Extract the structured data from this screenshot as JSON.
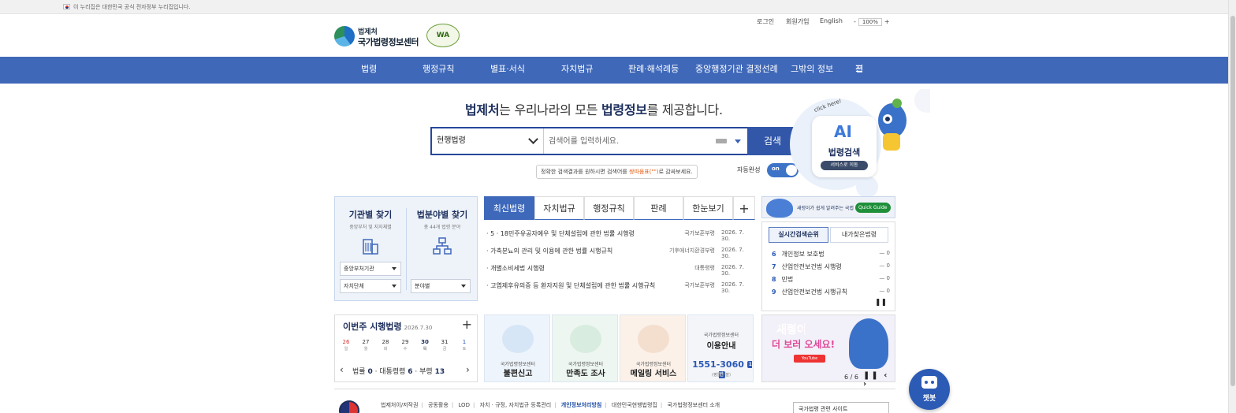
{
  "gov_notice": "이 누리집은 대한민국 공식 전자정부 누리집입니다.",
  "logo": {
    "line1": "법제처",
    "line2": "국가법령정보센터",
    "wa_mark": "WA"
  },
  "util": {
    "login": "로그인",
    "signup": "회원가입",
    "english": "English",
    "zoom": "100%",
    "zoom_minus": "-",
    "zoom_plus": "+"
  },
  "nav": {
    "items": [
      "법령",
      "행정규칙",
      "별표·서식",
      "자치법규",
      "판례·해석례등",
      "중앙행정기관 결정선례",
      "그밖의 정보"
    ],
    "all_menu": "전체메뉴"
  },
  "hero": {
    "headline_b1": "법제처",
    "headline_t1": "는 우리나라의 모든 ",
    "headline_b2": "법령정보",
    "headline_t2": "를 제공합니다.",
    "search_scope": "현행법령",
    "search_placeholder": "검색어를 입력하세요.",
    "search_button": "검색",
    "tip_pre": "정확한 검색결과를 원하시면 검색어를 ",
    "tip_em": "쌍따옴표(\"\")",
    "tip_post": "로 감싸보세요.",
    "autocomplete_label": "자동완성",
    "autocomplete_state": "on"
  },
  "ai": {
    "click": "click here!",
    "big": "AI",
    "title": "법령검색",
    "pill": "서비스로 이동"
  },
  "finder": {
    "agency_title": "기관별 찾기",
    "agency_sub": "중앙부처 및 지자체별",
    "field_title": "법분야별 찾기",
    "field_sub": "총 44개 법령 분야",
    "select_central": "중앙부처기관",
    "select_local": "자치단체",
    "select_field": "분야별"
  },
  "tabs": [
    "최신법령",
    "자치법규",
    "행정규칙",
    "판례",
    "한눈보기",
    "+"
  ],
  "news": [
    {
      "title": "· 5 · 18민주유공자예우 및 단체설립에 관한 법률 시행령",
      "org": "국가보훈부령",
      "date": "2026. 7. 30."
    },
    {
      "title": "· 가축분뇨의 관리 및 이용에 관한 법률 시행규칙",
      "org": "기후에너지환경부령",
      "date": "2026. 7. 30."
    },
    {
      "title": "· 개별소비세법 시행령",
      "org": "대통령령",
      "date": "2026. 7. 30."
    },
    {
      "title": "· 고엽제후유의증 등 환자지원 및 단체설립에 관한 법률 시행규칙",
      "org": "국가보훈부령",
      "date": "2026. 7. 30."
    }
  ],
  "quick_guide": {
    "text": "새렁이가 쉽게 알려주는 국법",
    "badge": "Quick Guide"
  },
  "ranking": {
    "tab_realtime": "실시간검색순위",
    "tab_mine": "내가찾은법령",
    "rows": [
      {
        "n": "6",
        "name": "개인정보 보호법",
        "chg": "— 0"
      },
      {
        "n": "7",
        "name": "산업안전보건법 시행령",
        "chg": "— 0"
      },
      {
        "n": "8",
        "name": "민법",
        "chg": "— 0"
      },
      {
        "n": "9",
        "name": "산업안전보건법 시행규칙",
        "chg": "— 0"
      }
    ],
    "pause": "❚❚"
  },
  "week": {
    "title": "이번주 시행법령",
    "date": "2026.7.30",
    "plus": "+",
    "days": [
      {
        "d": "26",
        "w": "일"
      },
      {
        "d": "27",
        "w": "월"
      },
      {
        "d": "28",
        "w": "화"
      },
      {
        "d": "29",
        "w": "수"
      },
      {
        "d": "30",
        "w": "목"
      },
      {
        "d": "31",
        "w": "금"
      },
      {
        "d": "1",
        "w": "토"
      }
    ],
    "law_label": "법률",
    "law_n": "0",
    "pres_label": "대통령령",
    "pres_n": "6",
    "min_label": "부령",
    "min_n": "13"
  },
  "tiles": [
    {
      "sm": "국가법령정보센터",
      "lg": "불편신고"
    },
    {
      "sm": "국가법령정보센터",
      "lg": "만족도 조사"
    },
    {
      "sm": "국가법령정보센터",
      "lg": "메일링 서비스"
    }
  ],
  "info_tile": {
    "sm": "국가법령정보센터",
    "lg": "이용안내",
    "tel": "1551-3060",
    "badge": "1번",
    "note": "(평일/주말)"
  },
  "banner2": {
    "t1": "새령이",
    "t2": "더 보러 오세요!",
    "yt": "YouTube",
    "page": "6 / 6",
    "controls": "❚❚ ‹ ›"
  },
  "chatbot": "챗봇",
  "footer": {
    "links": [
      "법제처이/저작권",
      "공동활용",
      "LOD",
      "자치 · 규정, 자치법규 등록관리",
      "개인정보처리방침",
      "대한민국현행법령집",
      "국가법령정보센터 소개"
    ],
    "related_site": "국가법령 관련 사이트"
  }
}
